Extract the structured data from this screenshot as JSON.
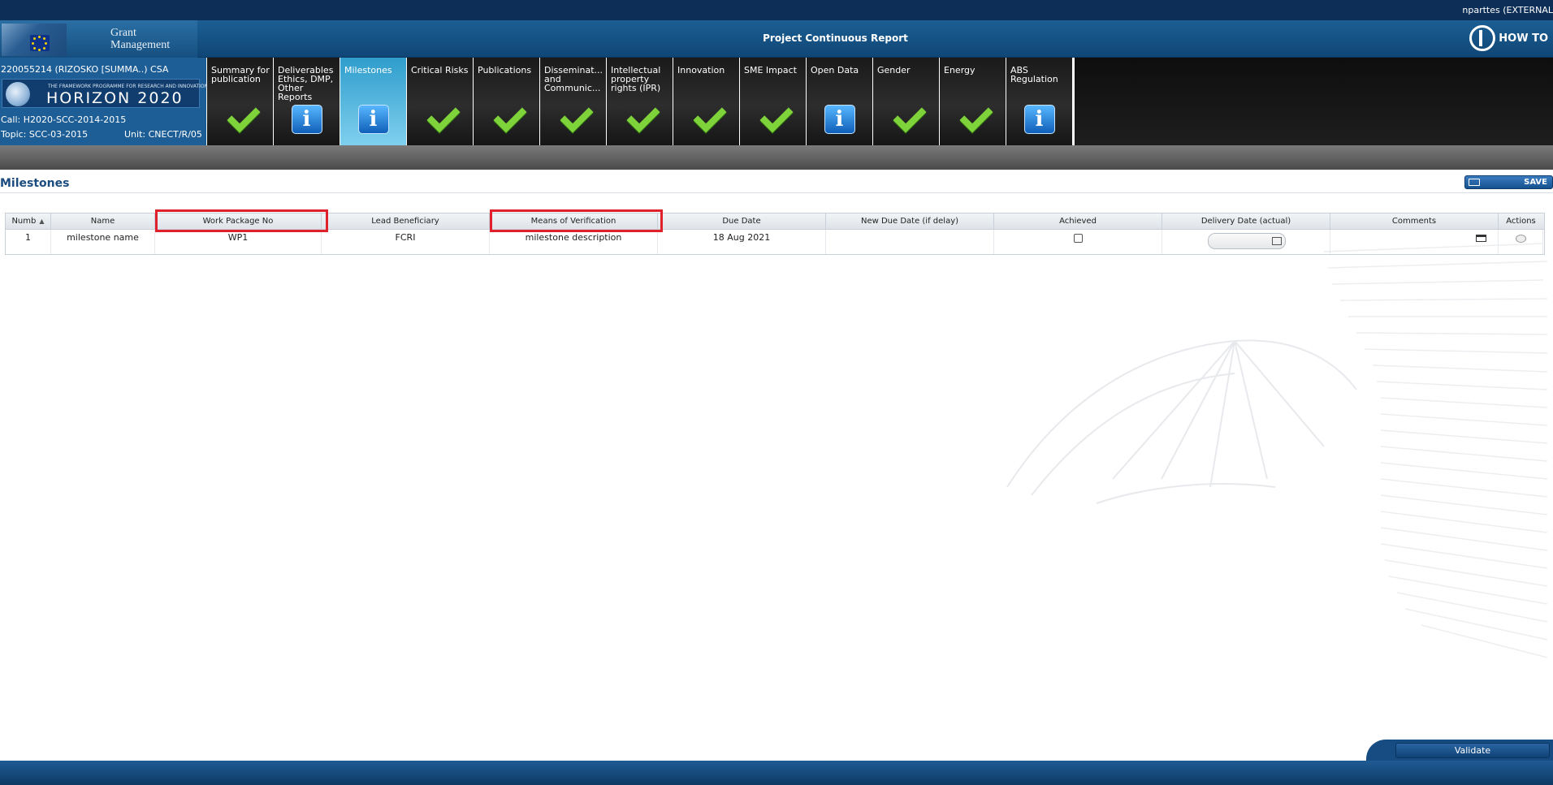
{
  "header": {
    "user": "nparttes (EXTERNAL",
    "brand_line1": "Grant",
    "brand_line2": "Management",
    "page_title": "Project Continuous Report",
    "howto_label": "HOW TO"
  },
  "project": {
    "id_line": "220055214 (RIZOSKO [SUMMA..) CSA",
    "programme_small": "THE FRAMEWORK PROGRAMME FOR RESEARCH AND INNOVATION",
    "programme_big": "HORIZON 2020",
    "call": "Call: H2020-SCC-2014-2015",
    "topic": "Topic: SCC-03-2015",
    "unit": "Unit: CNECT/R/05"
  },
  "tabs": [
    {
      "label": "Summary for publication",
      "icon": "check-icon",
      "active": false
    },
    {
      "label": "Deliverables Ethics, DMP, Other Reports",
      "icon": "info-icon",
      "active": false
    },
    {
      "label": "Milestones",
      "icon": "info-icon",
      "active": true
    },
    {
      "label": "Critical Risks",
      "icon": "check-icon",
      "active": false
    },
    {
      "label": "Publications",
      "icon": "check-icon",
      "active": false
    },
    {
      "label": "Disseminat... and Communic...",
      "icon": "check-icon",
      "active": false
    },
    {
      "label": "Intellectual property rights (IPR)",
      "icon": "check-icon",
      "active": false
    },
    {
      "label": "Innovation",
      "icon": "check-icon",
      "active": false
    },
    {
      "label": "SME Impact",
      "icon": "check-icon",
      "active": false
    },
    {
      "label": "Open Data",
      "icon": "info-icon",
      "active": false
    },
    {
      "label": "Gender",
      "icon": "check-icon",
      "active": false
    },
    {
      "label": "Energy",
      "icon": "check-icon",
      "active": false
    },
    {
      "label": "ABS Regulation",
      "icon": "info-icon",
      "active": false
    }
  ],
  "section": {
    "title": "Milestones",
    "save_label": "SAVE"
  },
  "table": {
    "columns": [
      "Numb",
      "Name",
      "Work Package No",
      "Lead Beneficiary",
      "Means of Verification",
      "Due Date",
      "New Due Date (if delay)",
      "Achieved",
      "Delivery Date (actual)",
      "Comments",
      "Actions"
    ],
    "rows": [
      {
        "number": "1",
        "name": "milestone name",
        "work_package": "WP1",
        "lead_beneficiary": "FCRI",
        "means_of_verification": "milestone description",
        "due_date": "18 Aug 2021",
        "new_due_date": "",
        "achieved": false,
        "delivery_date": ""
      }
    ]
  },
  "footer": {
    "validate_label": "Validate"
  },
  "colors": {
    "header_blue": "#0f4676",
    "active_tab": "#2f9dcc",
    "check_green": "#7fd33a",
    "highlight_red": "#e0212c"
  }
}
